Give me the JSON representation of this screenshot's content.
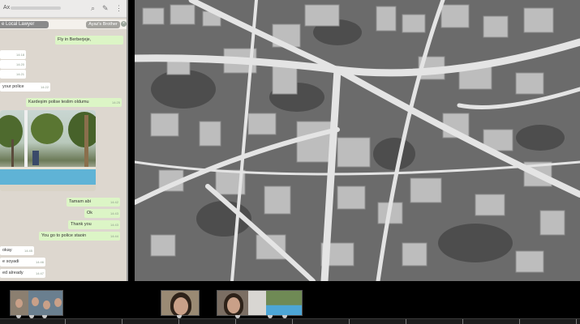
{
  "chat": {
    "topbar_prefix": "Ax",
    "icons": [
      "search-icon",
      "attach-icon",
      "more-icon"
    ],
    "contact_label": "e Local Lawyer",
    "contact_name": "Ayaz's Brother",
    "messages": [
      {
        "dir": "out",
        "text": "Fly in Berberjeje,",
        "time": ""
      },
      {
        "dir": "in",
        "text": "",
        "time": "14:18"
      },
      {
        "dir": "in",
        "text": "",
        "time": "14:20"
      },
      {
        "dir": "in",
        "text": "",
        "time": "14:21"
      },
      {
        "dir": "in",
        "text": "your police",
        "time": "14:22"
      },
      {
        "dir": "out",
        "text": "Kardeşim polise teslim oldumu",
        "time": "14:25"
      },
      {
        "dir": "out",
        "text": "Tamam abi",
        "time": "14:42"
      },
      {
        "dir": "out",
        "text": "Ok",
        "time": "14:43"
      },
      {
        "dir": "out",
        "text": "Thank you",
        "time": "14:43"
      },
      {
        "dir": "out",
        "text": "You go to police staoin",
        "time": "14:44"
      },
      {
        "dir": "in",
        "text": "okay",
        "time": "14:45"
      },
      {
        "dir": "in",
        "text": "e soyadi",
        "time": "14:46"
      },
      {
        "dir": "in",
        "text": "ed already",
        "time": "14:47"
      }
    ]
  },
  "timeline": {
    "clips": [
      "group-photo-clip",
      "face-closeup-clip",
      "face-closeup-and-pool-clip"
    ]
  }
}
